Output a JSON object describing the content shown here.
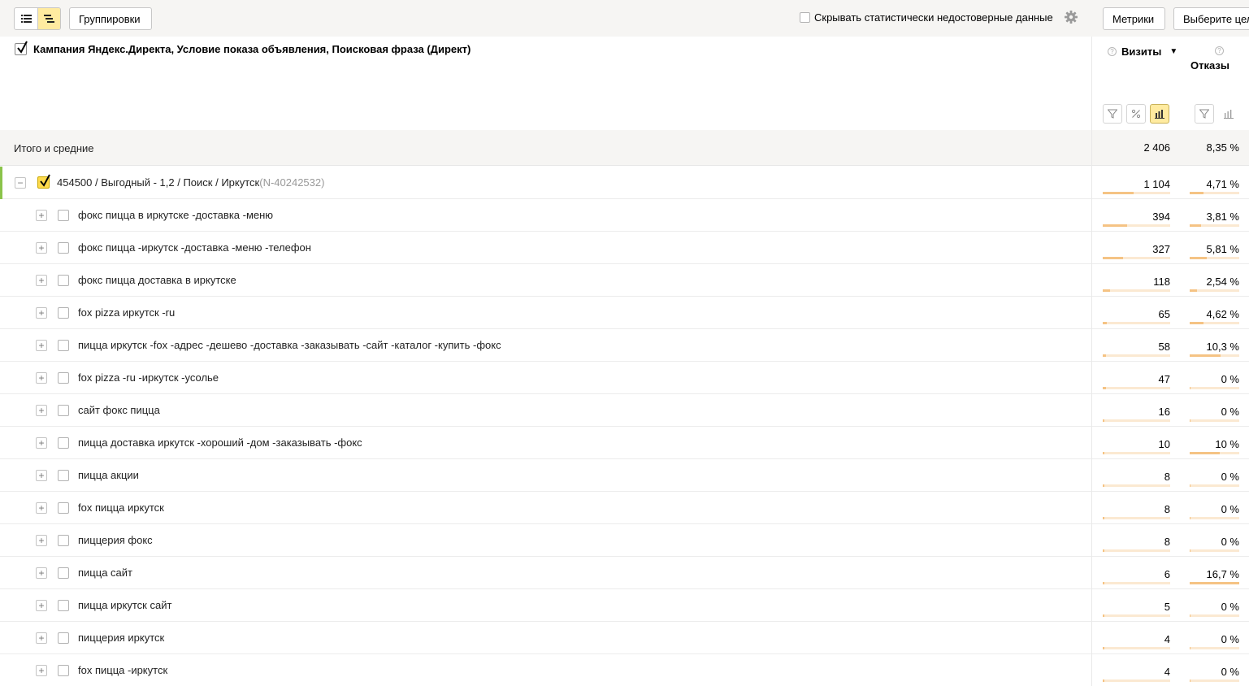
{
  "toolbar": {
    "view_list_icon": "list-icon",
    "view_tree_icon": "tree-icon",
    "groupings_label": "Группировки",
    "hide_unreliable_label": "Скрывать статистически недостоверные данные",
    "hide_unreliable_checked": false,
    "metrics_label": "Метрики",
    "choose_goal_label": "Выберите цел"
  },
  "header": {
    "dimensions_label": "Кампания Яндекс.Директа, Условие показа объявления, Поисковая фраза (Директ)",
    "columns": {
      "visits": "Визиты",
      "visits_sort": "▼",
      "bounces": "Отказы"
    },
    "help_mark": "?"
  },
  "totals": {
    "label": "Итого и средние",
    "visits": "2 406",
    "bounces": "8,35 %"
  },
  "parent_row": {
    "label": "454500 / Выгодный - 1,2 / Поиск / Иркутск",
    "id": "(N-40242532)",
    "expander": "−",
    "visits": "1 104",
    "bounces": "4,71 %",
    "visits_share": 0.459,
    "bounces_share": 0.282
  },
  "rows": [
    {
      "label": "фокс пицца в иркутске -доставка -меню",
      "visits": "394",
      "bounces": "3,81 %",
      "visits_share": 0.357,
      "bounces_share": 0.228
    },
    {
      "label": "фокс пицца -иркутск -доставка -меню -телефон",
      "visits": "327",
      "bounces": "5,81 %",
      "visits_share": 0.296,
      "bounces_share": 0.348
    },
    {
      "label": "фокс пицца доставка в иркутске",
      "visits": "118",
      "bounces": "2,54 %",
      "visits_share": 0.107,
      "bounces_share": 0.152
    },
    {
      "label": "fox pizza иркутск -ru",
      "visits": "65",
      "bounces": "4,62 %",
      "visits_share": 0.059,
      "bounces_share": 0.277
    },
    {
      "label": "пицца иркутск -fox -адрес -дешево -доставка -заказывать -сайт -каталог -купить -фокс",
      "visits": "58",
      "bounces": "10,3 %",
      "visits_share": 0.053,
      "bounces_share": 0.617
    },
    {
      "label": "fox pizza -ru -иркутск -усолье",
      "visits": "47",
      "bounces": "0 %",
      "visits_share": 0.043,
      "bounces_share": 0
    },
    {
      "label": "сайт фокс пицца",
      "visits": "16",
      "bounces": "0 %",
      "visits_share": 0.014,
      "bounces_share": 0
    },
    {
      "label": "пицца доставка иркутск -хороший -дом -заказывать -фокс",
      "visits": "10",
      "bounces": "10 %",
      "visits_share": 0.009,
      "bounces_share": 0.599
    },
    {
      "label": "пицца акции",
      "visits": "8",
      "bounces": "0 %",
      "visits_share": 0.007,
      "bounces_share": 0
    },
    {
      "label": "fox пицца иркутск",
      "visits": "8",
      "bounces": "0 %",
      "visits_share": 0.007,
      "bounces_share": 0
    },
    {
      "label": "пиццерия фокс",
      "visits": "8",
      "bounces": "0 %",
      "visits_share": 0.007,
      "bounces_share": 0
    },
    {
      "label": "пицца сайт",
      "visits": "6",
      "bounces": "16,7 %",
      "visits_share": 0.005,
      "bounces_share": 1.0
    },
    {
      "label": "пицца иркутск сайт",
      "visits": "5",
      "bounces": "0 %",
      "visits_share": 0.005,
      "bounces_share": 0
    },
    {
      "label": "пиццерия иркутск",
      "visits": "4",
      "bounces": "0 %",
      "visits_share": 0.004,
      "bounces_share": 0
    },
    {
      "label": "fox пицца -иркутск",
      "visits": "4",
      "bounces": "0 %",
      "visits_share": 0.004,
      "bounces_share": 0
    }
  ],
  "row_expander": "+",
  "colors": {
    "accent_yellow": "#ffdb4d",
    "active_button": "#ffeba0",
    "bar_fill": "#f5c384",
    "bar_track": "#fbe9d2",
    "parent_accent": "#8bc34a"
  }
}
